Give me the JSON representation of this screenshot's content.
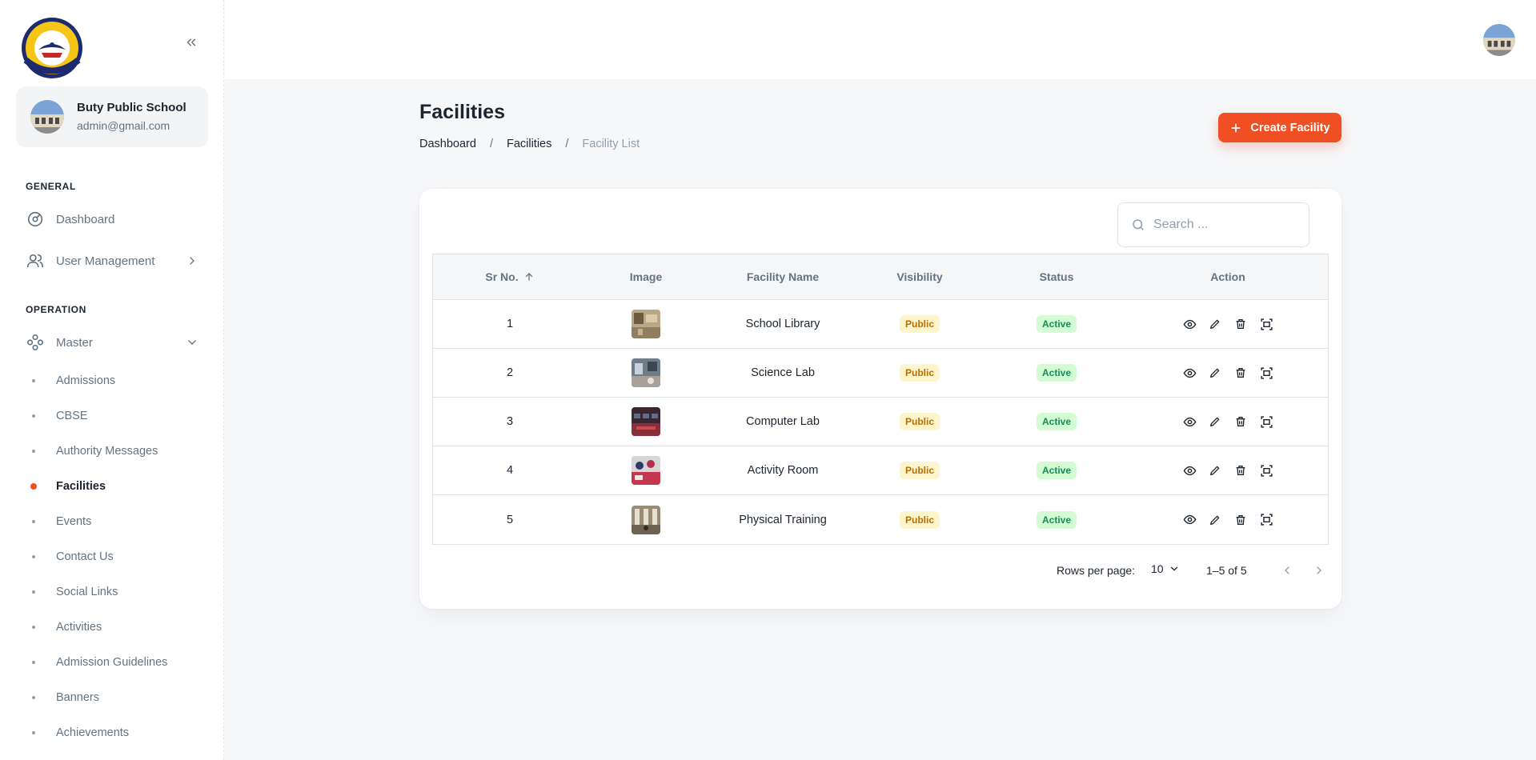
{
  "sidebar": {
    "account": {
      "name": "Buty Public School",
      "email": "admin@gmail.com"
    },
    "sections": {
      "general": "GENERAL",
      "operation": "OPERATION"
    },
    "nav": {
      "dashboard": "Dashboard",
      "user_management": "User Management",
      "master": "Master"
    },
    "master_items": [
      "Admissions",
      "CBSE",
      "Authority Messages",
      "Facilities",
      "Events",
      "Contact Us",
      "Social Links",
      "Activities",
      "Admission Guidelines",
      "Banners",
      "Achievements"
    ],
    "active_item": "Facilities"
  },
  "header": {
    "title": "Facilities",
    "breadcrumb": [
      "Dashboard",
      "Facilities",
      "Facility List"
    ],
    "separator": "/",
    "create_button": "Create Facility"
  },
  "search": {
    "placeholder": "Search ..."
  },
  "table": {
    "columns": [
      "Sr No.",
      "Image",
      "Facility Name",
      "Visibility",
      "Status",
      "Action"
    ],
    "rows": [
      {
        "sr": "1",
        "name": "School Library",
        "visibility": "Public",
        "status": "Active"
      },
      {
        "sr": "2",
        "name": "Science Lab",
        "visibility": "Public",
        "status": "Active"
      },
      {
        "sr": "3",
        "name": "Computer Lab",
        "visibility": "Public",
        "status": "Active"
      },
      {
        "sr": "4",
        "name": "Activity Room",
        "visibility": "Public",
        "status": "Active"
      },
      {
        "sr": "5",
        "name": "Physical Training",
        "visibility": "Public",
        "status": "Active"
      }
    ]
  },
  "pagination": {
    "rows_per_page_label": "Rows per page:",
    "rows_per_page": "10",
    "range": "1–5 of 5"
  },
  "colors": {
    "accent": "#F04E23",
    "public_badge": "#FFF5CC",
    "active_badge": "#D3FCD2"
  },
  "icons": [
    "collapse-icon",
    "dashboard-icon",
    "users-icon",
    "master-icon",
    "chevron-right-icon",
    "chevron-down-icon",
    "plus-icon",
    "search-icon",
    "arrow-up-icon",
    "eye-icon",
    "pencil-icon",
    "trash-icon",
    "scan-icon",
    "chevron-left-icon"
  ]
}
